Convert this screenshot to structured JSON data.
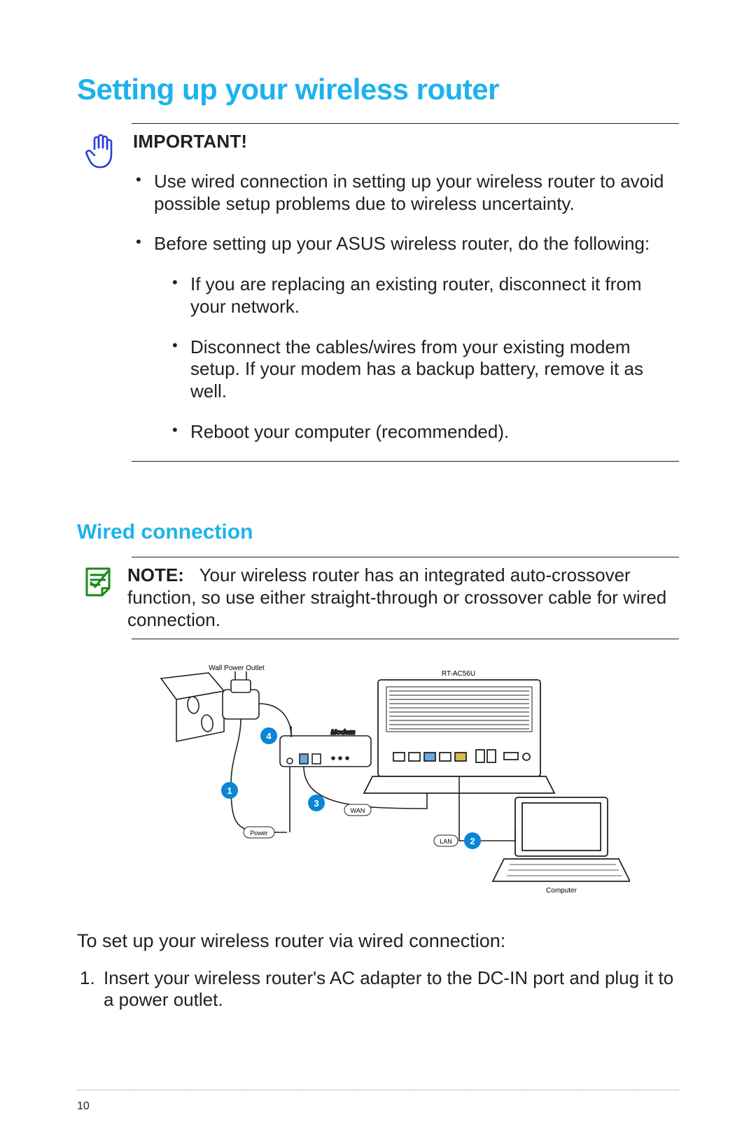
{
  "title": "Setting up your wireless router",
  "important": {
    "label": "IMPORTANT!",
    "bullets": [
      "Use wired connection in setting up your wireless router to avoid possible setup problems due to wireless uncertainty.",
      "Before setting up your ASUS wireless router, do the following:"
    ],
    "sub_bullets": [
      "If you are replacing an existing router, disconnect it from your network.",
      "Disconnect the cables/wires from your existing modem setup. If your modem has a backup battery, remove it as well.",
      "Reboot your computer (recommended)."
    ]
  },
  "subhead": "Wired connection",
  "note": {
    "label": "NOTE:",
    "text": "Your wireless router has an integrated auto-crossover function, so use either straight-through or crossover cable for wired connection."
  },
  "diagram": {
    "wall_outlet_label": "Wall Power Outlet",
    "router_label": "RT-AC56U",
    "modem_label": "Modem",
    "wan_label": "WAN",
    "power_label": "Power",
    "lan_label": "LAN",
    "computer_label": "Computer",
    "callouts": {
      "one": "1",
      "two": "2",
      "three": "3",
      "four": "4"
    }
  },
  "lead": "To set up your wireless router via wired connection:",
  "steps": [
    "Insert your wireless router's AC adapter to the DC-IN port and plug it to a power outlet."
  ],
  "page_number": "10"
}
